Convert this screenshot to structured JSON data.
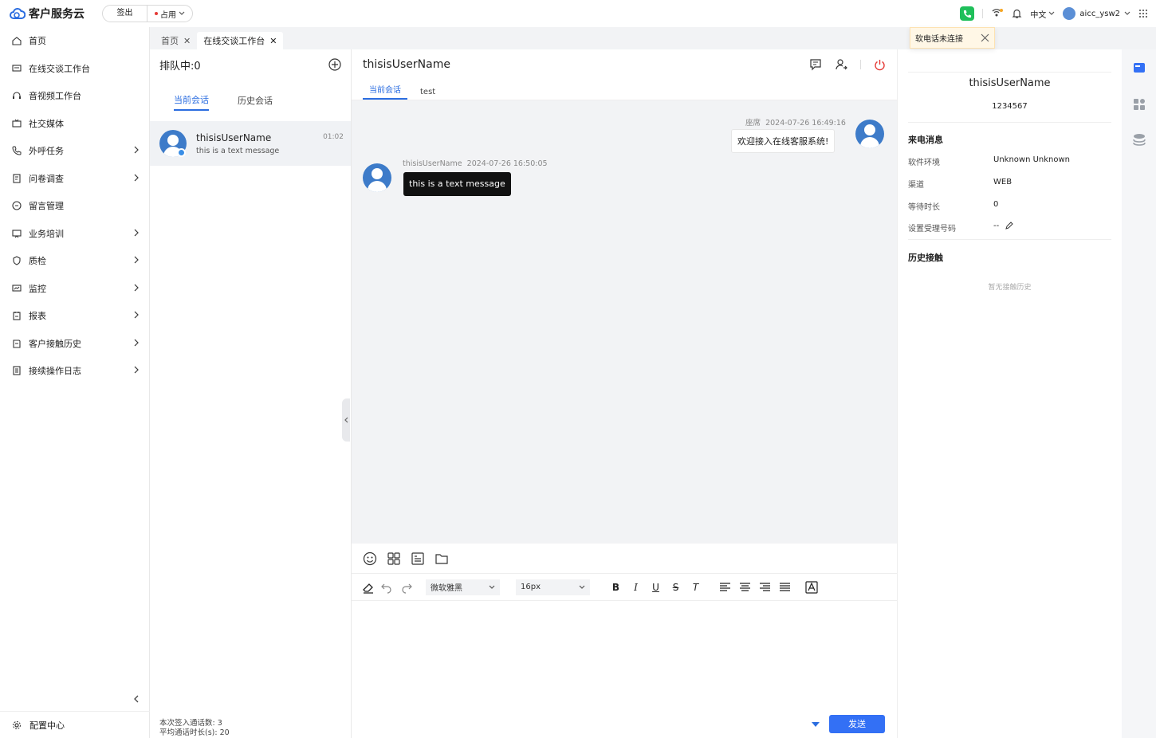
{
  "app": {
    "title": "客户服务云"
  },
  "topbar": {
    "signout_label": "签出",
    "status_label": "占用",
    "lang_label": "中文",
    "username": "aicc_ysw2"
  },
  "sidebar": {
    "items": [
      {
        "label": "首页",
        "icon": "home-icon",
        "has_sub": false
      },
      {
        "label": "在线交谈工作台",
        "icon": "chat-icon",
        "has_sub": false
      },
      {
        "label": "音视频工作台",
        "icon": "headset-icon",
        "has_sub": false
      },
      {
        "label": "社交媒体",
        "icon": "tv-icon",
        "has_sub": false
      },
      {
        "label": "外呼任务",
        "icon": "phone-icon",
        "has_sub": true
      },
      {
        "label": "问卷调查",
        "icon": "survey-icon",
        "has_sub": true
      },
      {
        "label": "留言管理",
        "icon": "message-icon",
        "has_sub": false
      },
      {
        "label": "业务培训",
        "icon": "training-icon",
        "has_sub": true
      },
      {
        "label": "质检",
        "icon": "shield-icon",
        "has_sub": true
      },
      {
        "label": "监控",
        "icon": "monitor-icon",
        "has_sub": true
      },
      {
        "label": "报表",
        "icon": "report-icon",
        "has_sub": true
      },
      {
        "label": "客户接触历史",
        "icon": "history-icon",
        "has_sub": true
      },
      {
        "label": "接续操作日志",
        "icon": "log-icon",
        "has_sub": true
      }
    ],
    "config_label": "配置中心"
  },
  "tabs": [
    {
      "label": "首页"
    },
    {
      "label": "在线交谈工作台"
    }
  ],
  "toast": {
    "text": "软电话未连接"
  },
  "convlist": {
    "queue_label": "排队中:0",
    "subtabs": [
      "当前会话",
      "历史会话"
    ],
    "items": [
      {
        "name": "thisisUserName",
        "message": "this is a text message",
        "time": "01:02"
      }
    ],
    "stats": {
      "line1": "本次签入通话数:  3",
      "line2": "平均通话时长(s):  20"
    }
  },
  "chat": {
    "title": "thisisUserName",
    "subtabs": [
      "当前会话",
      "test"
    ],
    "messages": [
      {
        "sender": "座席",
        "time": "2024-07-26 16:49:16",
        "text": "欢迎接入在线客服系统!"
      },
      {
        "sender": "thisisUserName",
        "time": "2024-07-26 16:50:05",
        "text": "this is a text message"
      }
    ],
    "font_family": "微软雅黑",
    "font_size": "16px",
    "send_label": "发送"
  },
  "customer": {
    "name": "thisisUserName",
    "id": "1234567",
    "section_call": "来电消息",
    "fields": [
      {
        "key": "软件环境",
        "value": "Unknown Unknown"
      },
      {
        "key": "渠道",
        "value": "WEB"
      },
      {
        "key": "等待时长",
        "value": "0"
      },
      {
        "key": "设置受理号码",
        "value": "--"
      }
    ],
    "section_history": "历史接触",
    "history_empty": "暂无接触历史"
  },
  "colors": {
    "accent": "#3370f5",
    "tab_active": "#2b6de0",
    "phone": "#1fbf5a",
    "danger": "#e53935"
  }
}
